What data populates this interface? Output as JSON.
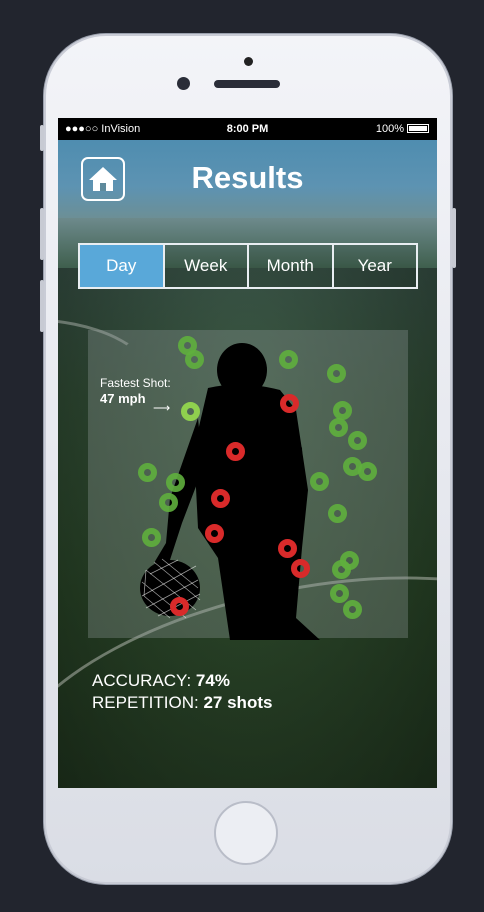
{
  "status": {
    "carrier": "●●●○○ InVision",
    "time": "8:00 PM",
    "battery": "100%"
  },
  "header": {
    "title": "Results",
    "home_icon": "home-icon"
  },
  "tabs": [
    {
      "label": "Day",
      "active": true
    },
    {
      "label": "Week",
      "active": false
    },
    {
      "label": "Month",
      "active": false
    },
    {
      "label": "Year",
      "active": false
    }
  ],
  "fastest": {
    "label": "Fastest Shot:",
    "value": "47 mph"
  },
  "stats": {
    "accuracy_label": "ACCURACY:",
    "accuracy_value": "74%",
    "repetition_label": "REPETITION:",
    "repetition_value": "27 shots"
  },
  "shots": {
    "goals": 20,
    "misses": 7,
    "colors": {
      "goal": "#5faf3d",
      "miss": "#d92a2a",
      "fastest": "#8fd04e",
      "active_tab": "#59a8d9"
    }
  }
}
